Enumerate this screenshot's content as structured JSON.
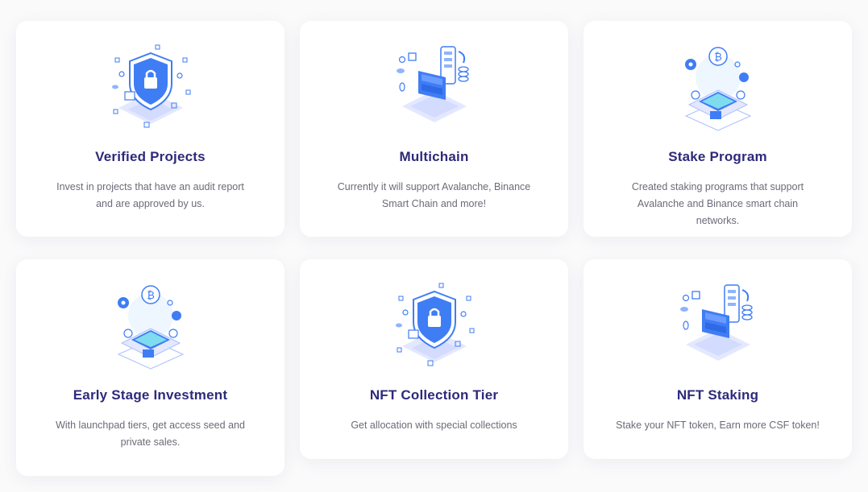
{
  "features": [
    {
      "title": "Verified Projects",
      "description": "Invest in projects that have an audit report and are approved by us.",
      "icon": "shield-lock-icon"
    },
    {
      "title": "Multichain",
      "description": "Currently it will support Avalanche, Binance Smart Chain and more!",
      "icon": "multichain-icon"
    },
    {
      "title": "Stake Program",
      "description": "Created staking programs that support Avalanche and Binance smart chain networks.",
      "icon": "staking-platform-icon"
    },
    {
      "title": "Early Stage Investment",
      "description": "With launchpad tiers, get access seed and private sales.",
      "icon": "launchpad-platform-icon"
    },
    {
      "title": "NFT Collection Tier",
      "description": "Get allocation with special collections",
      "icon": "shield-lock-icon"
    },
    {
      "title": "NFT Staking",
      "description": "Stake your NFT token, Earn more CSF token!",
      "icon": "multichain-icon"
    }
  ],
  "colors": {
    "title": "#2d2a7a",
    "text": "#6b6b78",
    "accent": "#3f7df5",
    "accent_light": "#dfe5ff"
  }
}
